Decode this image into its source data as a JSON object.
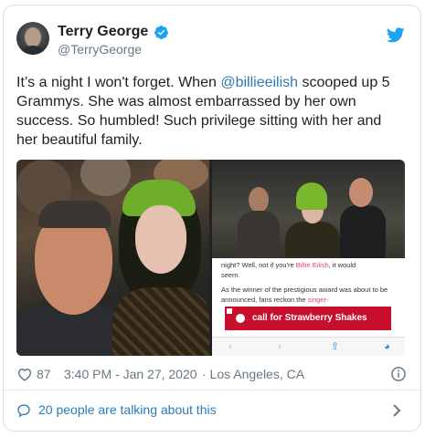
{
  "author": {
    "name": "Terry George",
    "handle": "@TerryGeorge",
    "verified": true
  },
  "tweet": {
    "text_before": "It’s a night I won't forget. When ",
    "mention": "@billieeilish",
    "text_after": " scooped up 5 Grammys. She was almost embarrassed by her own success. So humbled! Such privilege sitting with her and her beautiful family."
  },
  "media": {
    "article_line1_a": "night? Well, not if you're ",
    "article_line1_hl": "Billie Eilish",
    "article_line1_b": ", it would",
    "article_line2": "seem.",
    "article_para2_a": "As the winner of the prestigious award was about to be announced, fans reckon the ",
    "article_para2_hl": "singer-",
    "ad_text": "call for Strawberry Shakes"
  },
  "footer": {
    "likes": "87",
    "timestamp": "3:40 PM - Jan 27, 2020",
    "location": "· Los Angeles, CA",
    "talking": "20 people are talking about this"
  },
  "colors": {
    "link": "#2b7bb9",
    "twitter_blue": "#1da1f2",
    "meta_gray": "#697882",
    "ad_red": "#c8102e"
  },
  "icons": [
    "verified-badge-icon",
    "twitter-bird-icon",
    "heart-icon",
    "info-icon",
    "speech-bubble-icon",
    "chevron-right-icon"
  ]
}
